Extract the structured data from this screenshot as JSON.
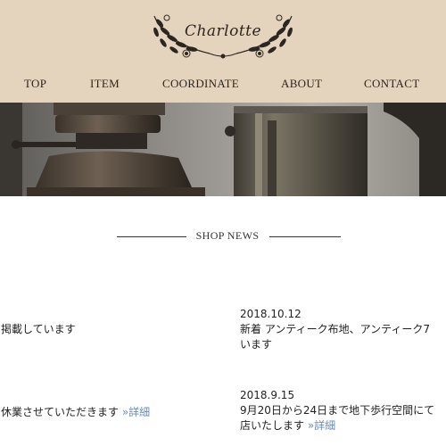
{
  "header": {
    "brand": "Charlotte",
    "background": "#e4d3bd"
  },
  "nav": {
    "items": [
      {
        "label": "TOP"
      },
      {
        "label": "ITEM"
      },
      {
        "label": "COORDINATE"
      },
      {
        "label": "ABOUT"
      },
      {
        "label": "CONTACT"
      }
    ]
  },
  "news": {
    "heading": "SHOP NEWS",
    "left_items": [
      {
        "text": "掲載しています",
        "link": ""
      },
      {
        "text": "休業させていただきます",
        "link": "»詳細"
      }
    ],
    "right_items": [
      {
        "date": "2018.10.12",
        "line1": "新着 アンティーク布地、アンティーク7",
        "line2": "います",
        "link": ""
      },
      {
        "date": "2018.9.15",
        "line1": "9月20日から24日まで地下歩行空間にて",
        "line2": "店いたします",
        "link": "»詳細"
      }
    ]
  },
  "colors": {
    "header_bg": "#e4d3bd",
    "link": "#6b8db8",
    "text": "#222222"
  }
}
